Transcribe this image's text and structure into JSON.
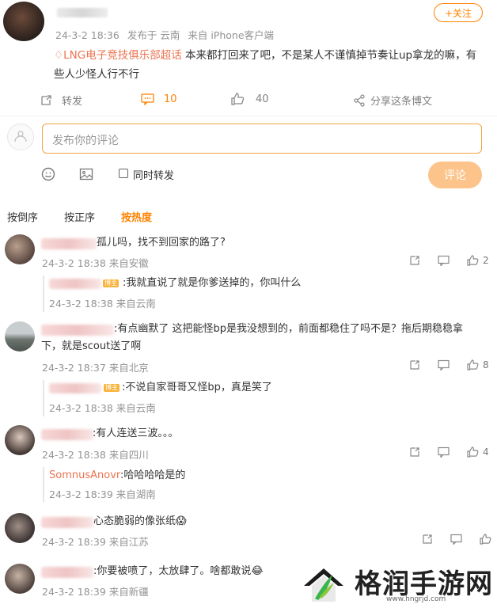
{
  "post": {
    "time": "24-3-2 18:36",
    "source_prefix": "发布于",
    "location": "云南",
    "device_prefix": "来自",
    "device": "iPhone客户端",
    "follow_label": "+关注",
    "topic": "LNG电子竞技俱乐部超话",
    "text": " 本来都打回来了吧，不是某人不谨慎掉节奏让up拿龙的嘛，有些人少怪人行不行",
    "actions": {
      "repost_label": "转发",
      "comment_count": "10",
      "like_count": "40",
      "share_label": "分享这条博文"
    }
  },
  "composer": {
    "placeholder": "发布你的评论",
    "also_repost_label": "同时转发",
    "submit_label": "评论"
  },
  "sort_tabs": [
    "按倒序",
    "按正序",
    "按热度"
  ],
  "comments": [
    {
      "text": "孤儿吗，找不到回家的路了?",
      "meta": "24-3-2 18:38 来自安徽",
      "likes": "2",
      "reply": {
        "badge": "博主",
        "text": ":我就直说了就是你爹送掉的，你叫什么",
        "meta": "24-3-2 18:38 来自云南"
      }
    },
    {
      "text": ":有点幽默了 这把能怪bp是我没想到的，前面都稳住了吗不是？拖后期稳稳拿下，就是scout送了啊",
      "meta": "24-3-2 18:37 来自北京",
      "likes": "8",
      "reply": {
        "badge": "博主",
        "text": ":不说自家哥哥又怪bp，真是笑了",
        "meta": "24-3-2 18:38 来自云南"
      }
    },
    {
      "text": ":有人连送三波。。。",
      "meta": "24-3-2 18:38 来自四川",
      "likes": "4",
      "reply": {
        "user": "SomnusAnovr",
        "text": ":哈哈哈哈是的",
        "meta": "24-3-2 18:39 来自湖南"
      }
    },
    {
      "text": "心态脆弱的像张纸😱",
      "meta": "24-3-2 18:39 来自江苏",
      "likes": ""
    },
    {
      "text": ":你要被喷了，太放肆了。啥都敢说😂",
      "meta": "24-3-2 18:39 来自新疆",
      "likes": ""
    }
  ],
  "watermark": {
    "name": "格润手游网",
    "url": "www.hngrjd.com"
  }
}
